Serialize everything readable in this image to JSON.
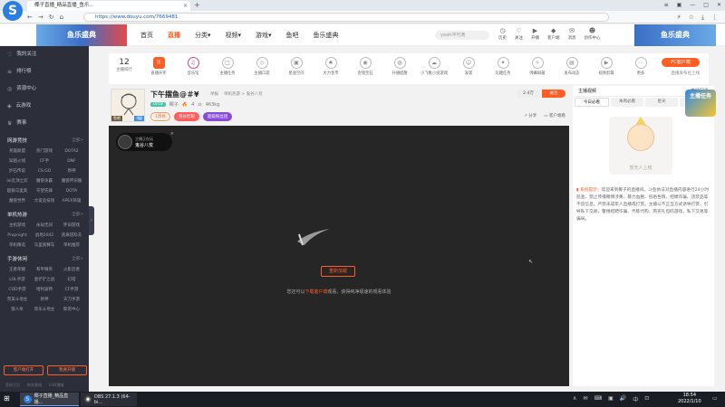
{
  "browser": {
    "tab_title": "椰子直播_精品直播_鱼乐..",
    "tab_close": "×",
    "tab_add": "+",
    "url": "https://www.douyu.com/7669481",
    "win_controls": [
      "≡",
      "▣",
      "—",
      "□",
      "✕"
    ],
    "nav_back": "←",
    "nav_forward": "→",
    "nav_reload": "↻",
    "nav_home": "⌂"
  },
  "site": {
    "banner_left": "鱼乐盛典",
    "banner_right": "鱼乐盛典",
    "nav": [
      {
        "label": "首页"
      },
      {
        "label": "直播",
        "active": true
      },
      {
        "label": "分类▾"
      },
      {
        "label": "视频▾"
      },
      {
        "label": "游戏▾"
      },
      {
        "label": "鱼吧"
      },
      {
        "label": "鱼乐盛典"
      }
    ],
    "search_placeholder": "yeah冲可滴",
    "tools": [
      {
        "icon": "◷",
        "label": "历史"
      },
      {
        "icon": "♡",
        "label": "关注"
      },
      {
        "icon": "▶",
        "label": "开播"
      },
      {
        "icon": "◆",
        "label": "客户端"
      },
      {
        "icon": "✉",
        "label": "消息"
      },
      {
        "icon": "☻",
        "label": "创作中心"
      }
    ]
  },
  "sidebar": {
    "main_items": [
      {
        "icon": "♡",
        "label": "我的关注"
      },
      {
        "icon": "≡",
        "label": "排行榜"
      },
      {
        "icon": "◎",
        "label": "资源中心"
      },
      {
        "icon": "◈",
        "label": "云游戏"
      },
      {
        "icon": "♛",
        "label": "赛事"
      }
    ],
    "sections": [
      {
        "title": "网游竞技",
        "more": "全部>",
        "items": [
          "英雄联盟",
          "热门游戏",
          "DOTA2",
          "穿越火线",
          "CF手",
          "DNF",
          "炉石传说",
          "CS:GO",
          "原神",
          "lol云顶之弈",
          "魔兽争霸",
          "魔兽怀旧服",
          "超级马里奥",
          "守望先锋",
          "DOTA",
          "魔兽世界",
          "大诞竞技场",
          "APEX英雄"
        ]
      },
      {
        "title": "单机热游",
        "more": "全部>",
        "items": [
          "主机游戏",
          "永劫无间",
          "怀旧游戏",
          "Propnight",
          "战地2042",
          "逃离塔科夫",
          "单机精选",
          "马里奥赛车",
          "单机推荐"
        ]
      },
      {
        "title": "手游休闲",
        "more": "全部>",
        "items": [
          "王者荣耀",
          "和平精英",
          "火影忍者",
          "LOL手游",
          "金铲铲之战",
          "幻塔",
          "COD手游",
          "哈利波特",
          "CF手游",
          "完美斗地主",
          "原神",
          "天刀手游",
          "狼人杀",
          "欢乐斗地主",
          "斯诺中心"
        ]
      }
    ],
    "bottom_buttons": [
      "客户端打开",
      "我要开播"
    ],
    "footer": [
      "官网主页",
      "联系客服",
      "LIVE播放"
    ],
    "collapse": "‹"
  },
  "room_toolbar": {
    "rank_number": "12",
    "rank_label": "主播排行",
    "items": [
      {
        "icon": "热",
        "label": "直播开奖",
        "hot": true
      },
      {
        "icon": "♫",
        "label": "音乐馆",
        "live": true
      },
      {
        "icon": "□",
        "label": "主播任务"
      },
      {
        "icon": "◇",
        "label": "主播口袋"
      },
      {
        "icon": "▣",
        "label": "星座空间"
      },
      {
        "icon": "♠",
        "label": "大力金币"
      },
      {
        "icon": "◉",
        "label": "金钱宝石"
      },
      {
        "icon": "◍",
        "label": "开播提醒"
      },
      {
        "icon": "☁",
        "label": "小飞象小说游戏"
      },
      {
        "icon": "☺",
        "label": "发现"
      },
      {
        "icon": "✦",
        "label": "玩趣任务"
      },
      {
        "icon": "✧",
        "label": "弹幕屏蔽"
      },
      {
        "icon": "▤",
        "label": "发布动态"
      },
      {
        "icon": "▶",
        "label": "视频剪辑"
      },
      {
        "icon": "⋯",
        "label": "更多"
      }
    ],
    "pc_client": "PC客户端",
    "pc_sub": "直播发布拉上线"
  },
  "anchor": {
    "avatar_tag": "鱼吧",
    "avatar_level": "4级",
    "title": "下午摆鱼@＃¥",
    "sub": [
      "举报",
      "单机热游 > 鬼谷八荒"
    ],
    "level_badge": "LV18",
    "name": "椰子",
    "hot_icon": "🔥",
    "hot_count": "4",
    "fans": "463kg",
    "tags": [
      {
        "label": "1周榜",
        "style": "plain"
      },
      {
        "label": "鬼谷炸裂",
        "style": "red"
      },
      {
        "label": "超级粉丝团",
        "style": "purple"
      }
    ],
    "follow_count": "2.4万",
    "follow_label": "关注",
    "share": "分享",
    "client_watch": "客户端看"
  },
  "player": {
    "badge_line1": "主播正在玩",
    "badge_line2": "鬼谷八荒",
    "badge_close": "×",
    "refresh": "重新加载",
    "tip_prefix": "您还可以",
    "tip_link": "下载客户端",
    "tip_suffix": "观看，获得纯净极速的观看体验",
    "cursor": "↖"
  },
  "right_panel": {
    "top_tabs": [
      "主播视频",
      "直播回看"
    ],
    "tabs": [
      "今日必看",
      "本周必看",
      "星光",
      "贵宾"
    ],
    "task_badge": "主播任务",
    "illustration_text": "暂无人上榜",
    "notice_label": "系统提示：",
    "notice_text": "欢迎来到椰子的直播间。斗鱼依法对直播内容进行24小时巡查，禁止传播赌博涉黄、暴力血腥、低俗色情、招嫖诈骗、违禁品等不良信息。严禁未成年人直播或打赏。主播以不正当方式诱导打赏、引导私下交易，警惕招聘诈骗、代练代购、购买礼包码游戏，私下交易等骗局。"
  },
  "taskbar": {
    "start": "⊞",
    "apps": [
      {
        "icon": "S",
        "label": "椰子直播_精品直播..."
      },
      {
        "icon": "◉",
        "label": "OBS 27.1.3 (64-bi..."
      }
    ],
    "tray_icons": [
      "∧",
      "✉",
      "⌨",
      "▣",
      "🔊",
      "中",
      "⊡"
    ],
    "time": "18:54",
    "date": "2022/1/10",
    "notify": "▭"
  }
}
